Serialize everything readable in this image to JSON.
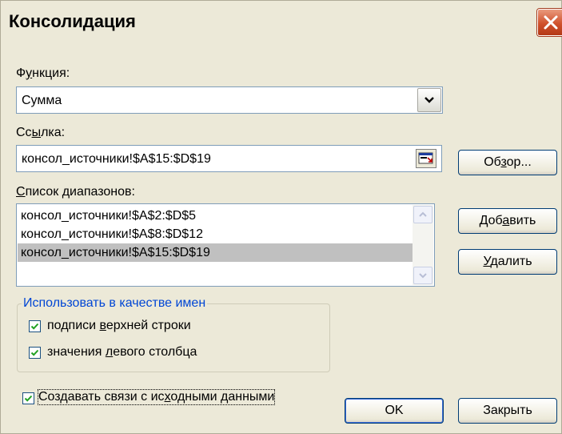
{
  "window": {
    "title": "Консолидация"
  },
  "function": {
    "label_prefix": "Ф",
    "label_underline": "у",
    "label_rest": "нкция:",
    "value": "Сумма"
  },
  "reference": {
    "label_prefix": "Сс",
    "label_underline": "ы",
    "label_rest": "лка:",
    "value": "консол_источники!$A$15:$D$19"
  },
  "ranges": {
    "label_underline": "С",
    "label_rest": "писок диапазонов:",
    "items": [
      "консол_источники!$A$2:$D$5",
      "консол_источники!$A$8:$D$12",
      "консол_источники!$A$15:$D$19"
    ],
    "selected_index": 2
  },
  "buttons": {
    "browse": {
      "prefix": "Об",
      "underline": "з",
      "rest": "ор..."
    },
    "add": {
      "prefix": "Доб",
      "underline": "а",
      "rest": "вить"
    },
    "delete": {
      "underline": "У",
      "rest": "далить"
    },
    "ok": "OK",
    "close": "Закрыть"
  },
  "use_names": {
    "title": "Использовать в качестве имен",
    "top_row": {
      "prefix": "подписи ",
      "underline": "в",
      "rest": "ерхней строки",
      "checked": true
    },
    "left_col": {
      "prefix": "значения ",
      "underline": "л",
      "rest": "евого столбца",
      "checked": true
    }
  },
  "create_links": {
    "prefix": "Создавать связи с ис",
    "underline": "х",
    "rest": "одными данными",
    "checked": true
  },
  "icons": {
    "close": "close-icon",
    "combo": "chevron-down-icon",
    "collapse": "collapse-dialog-icon",
    "scroll_up": "scroll-up-icon",
    "scroll_down": "scroll-down-icon",
    "check": "checkmark-icon"
  },
  "colors": {
    "group_title": "#0046d5",
    "dialog_bg": "#ece9d8",
    "selection": "#c0c0c0",
    "close_btn": "#d0512c"
  }
}
